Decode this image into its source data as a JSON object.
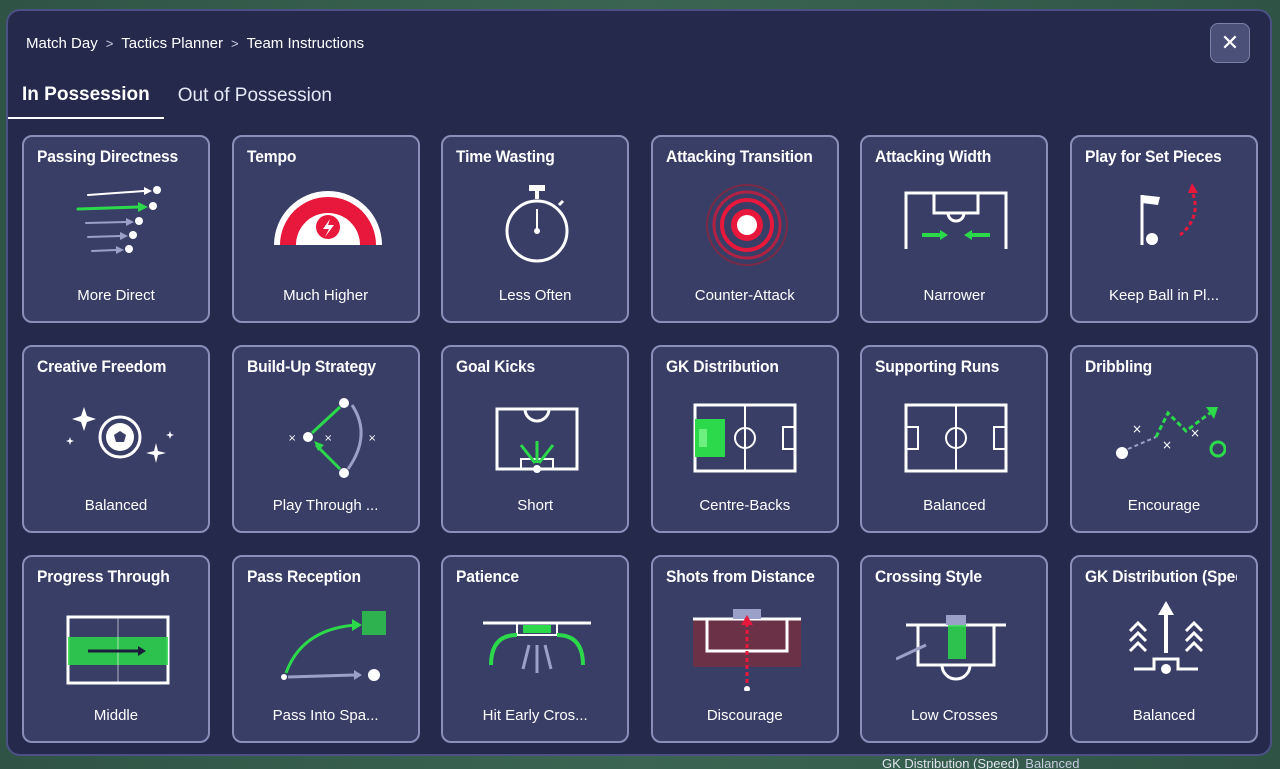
{
  "breadcrumb": [
    "Match Day",
    "Tactics Planner",
    "Team Instructions"
  ],
  "close_label": "✕",
  "tabs": [
    {
      "label": "In Possession",
      "active": true
    },
    {
      "label": "Out of Possession",
      "active": false
    }
  ],
  "instructions": [
    {
      "title": "Passing Directness",
      "value": "More Direct",
      "icon": "passing-directness"
    },
    {
      "title": "Tempo",
      "value": "Much Higher",
      "icon": "tempo"
    },
    {
      "title": "Time Wasting",
      "value": "Less Often",
      "icon": "stopwatch"
    },
    {
      "title": "Attacking Transition",
      "value": "Counter-Attack",
      "icon": "target"
    },
    {
      "title": "Attacking Width",
      "value": "Narrower",
      "icon": "attacking-width"
    },
    {
      "title": "Play for Set Pieces",
      "value": "Keep Ball in Pl...",
      "icon": "corner-flag"
    },
    {
      "title": "Creative Freedom",
      "value": "Balanced",
      "icon": "sparkle-ball"
    },
    {
      "title": "Build-Up Strategy",
      "value": "Play Through ...",
      "icon": "build-up"
    },
    {
      "title": "Goal Kicks",
      "value": "Short",
      "icon": "goal-kicks"
    },
    {
      "title": "GK Distribution",
      "value": "Centre-Backs",
      "icon": "gk-distribution"
    },
    {
      "title": "Supporting Runs",
      "value": "Balanced",
      "icon": "pitch"
    },
    {
      "title": "Dribbling",
      "value": "Encourage",
      "icon": "dribbling"
    },
    {
      "title": "Progress Through",
      "value": "Middle",
      "icon": "progress-through"
    },
    {
      "title": "Pass Reception",
      "value": "Pass Into Spa...",
      "icon": "pass-reception"
    },
    {
      "title": "Patience",
      "value": "Hit Early Cros...",
      "icon": "patience"
    },
    {
      "title": "Shots from Distance",
      "value": "Discourage",
      "icon": "shots-distance"
    },
    {
      "title": "Crossing Style",
      "value": "Low Crosses",
      "icon": "crossing-style"
    },
    {
      "title": "GK Distribution (Speed)",
      "value": "Balanced",
      "icon": "gk-speed"
    }
  ],
  "background_row": {
    "label": "GK Distribution (Speed)",
    "value": "Balanced"
  },
  "colors": {
    "accent_green": "#2bd94a",
    "accent_red": "#e8183c",
    "card_bg": "#393e66",
    "modal_bg": "#252a4d"
  }
}
